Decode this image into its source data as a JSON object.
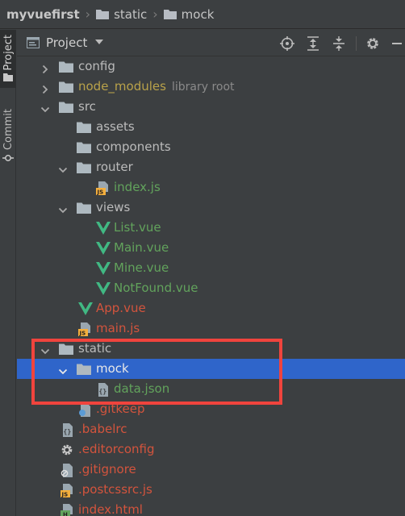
{
  "breadcrumb": {
    "project": "myvuefirst",
    "items": [
      "static",
      "mock"
    ]
  },
  "side_strip": {
    "project_tab": "Project",
    "commit_tab": "Commit"
  },
  "header": {
    "title": "Project"
  },
  "tree": [
    {
      "label": "config",
      "extra": "",
      "type": "folder",
      "indent": 0,
      "arrow": "right",
      "color": "default"
    },
    {
      "label": "node_modules",
      "extra": "library root",
      "type": "folder",
      "indent": 0,
      "arrow": "right",
      "color": "yellow"
    },
    {
      "label": "src",
      "extra": "",
      "type": "folder",
      "indent": 0,
      "arrow": "down",
      "color": "default"
    },
    {
      "label": "assets",
      "extra": "",
      "type": "folder",
      "indent": 1,
      "arrow": "none",
      "color": "default"
    },
    {
      "label": "components",
      "extra": "",
      "type": "folder",
      "indent": 1,
      "arrow": "none",
      "color": "default"
    },
    {
      "label": "router",
      "extra": "",
      "type": "folder",
      "indent": 1,
      "arrow": "down",
      "color": "default"
    },
    {
      "label": "index.js",
      "extra": "",
      "type": "js",
      "indent": 2,
      "arrow": "none",
      "color": "green"
    },
    {
      "label": "views",
      "extra": "",
      "type": "folder",
      "indent": 1,
      "arrow": "down",
      "color": "default"
    },
    {
      "label": "List.vue",
      "extra": "",
      "type": "vue",
      "indent": 2,
      "arrow": "none",
      "color": "green"
    },
    {
      "label": "Main.vue",
      "extra": "",
      "type": "vue",
      "indent": 2,
      "arrow": "none",
      "color": "green"
    },
    {
      "label": "Mine.vue",
      "extra": "",
      "type": "vue",
      "indent": 2,
      "arrow": "none",
      "color": "green"
    },
    {
      "label": "NotFound.vue",
      "extra": "",
      "type": "vue",
      "indent": 2,
      "arrow": "none",
      "color": "green"
    },
    {
      "label": "App.vue",
      "extra": "",
      "type": "vue",
      "indent": 1,
      "arrow": "none",
      "color": "red"
    },
    {
      "label": "main.js",
      "extra": "",
      "type": "js",
      "indent": 1,
      "arrow": "none",
      "color": "red"
    },
    {
      "label": "static",
      "extra": "",
      "type": "folder",
      "indent": 0,
      "arrow": "down",
      "color": "default"
    },
    {
      "label": "mock",
      "extra": "",
      "type": "folder",
      "indent": 1,
      "arrow": "down",
      "color": "white",
      "selected": true
    },
    {
      "label": "data.json",
      "extra": "",
      "type": "json",
      "indent": 2,
      "arrow": "none",
      "color": "green"
    },
    {
      "label": ".gitkeep",
      "extra": "",
      "type": "gitkeep",
      "indent": 1,
      "arrow": "none",
      "color": "red"
    },
    {
      "label": ".babelrc",
      "extra": "",
      "type": "json",
      "indent": 0,
      "arrow": "none",
      "color": "red"
    },
    {
      "label": ".editorconfig",
      "extra": "",
      "type": "gear",
      "indent": 0,
      "arrow": "none",
      "color": "red"
    },
    {
      "label": ".gitignore",
      "extra": "",
      "type": "ignore",
      "indent": 0,
      "arrow": "none",
      "color": "red"
    },
    {
      "label": ".postcssrc.js",
      "extra": "",
      "type": "js",
      "indent": 0,
      "arrow": "none",
      "color": "red"
    },
    {
      "label": "index.html",
      "extra": "",
      "type": "html",
      "indent": 0,
      "arrow": "none",
      "color": "red"
    }
  ]
}
